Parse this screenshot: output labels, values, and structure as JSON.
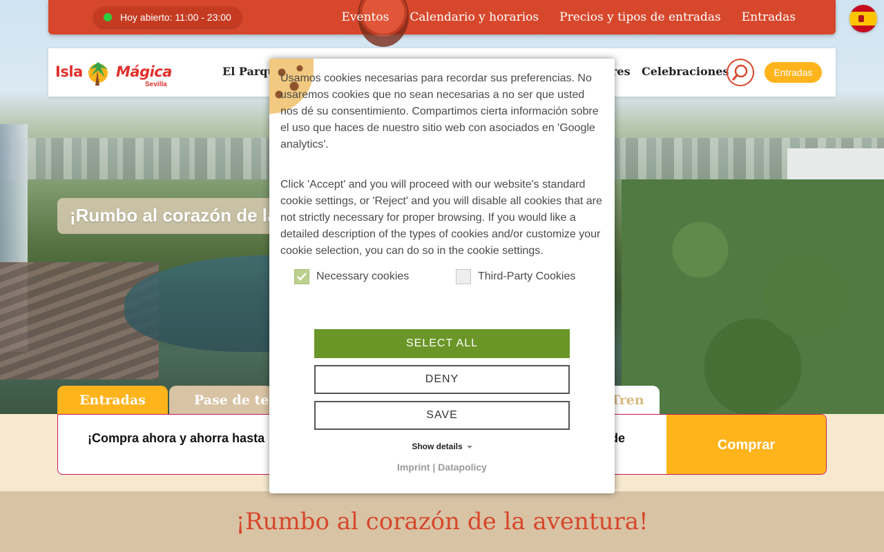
{
  "topbar": {
    "open_status": "Hoy abierto: 11:00 - 23:00",
    "nav": [
      "Eventos",
      "Calendario y horarios",
      "Precios y tipos de entradas",
      "Entradas"
    ],
    "language_flag": "spain-flag"
  },
  "mainbar": {
    "logo": {
      "word1": "Isla",
      "word2": "Mágica",
      "city": "Sevilla"
    },
    "nav_left": "El Parque",
    "nav_mid": "res",
    "nav_right": "Celebraciones",
    "search_icon": "search-icon",
    "tickets_button": "Entradas"
  },
  "hero": {
    "title": "¡Rumbo al corazón de la aventura!"
  },
  "tabs": [
    "Entradas",
    "Pase de temporada",
    "Tren"
  ],
  "promo": {
    "text_left": "¡Compra ahora y ahorra hasta",
    "text_right": "sde",
    "buy_button": "Comprar"
  },
  "bottom": {
    "title": "¡Rumbo al corazón de la aventura!"
  },
  "cookie": {
    "paragraph1": "Usamos cookies necesarias para recordar sus preferencias. No usaremos cookies que no sean necesarias a no ser que usted nos dé su consentimiento. Compartimos cierta información sobre el uso que haces de nuestro sitio web con asociados en 'Google analytics'.",
    "paragraph2": "Click 'Accept' and you will proceed with our website's standard cookie settings, or 'Reject' and you will disable all cookies that are not strictly necessary for proper browsing. If you would like a detailed description of the types of cookies and/or customize your cookie selection, you can do so in the cookie settings.",
    "checkbox_necessary": "Necessary cookies",
    "checkbox_third_party": "Third-Party Cookies",
    "select_all": "SELECT ALL",
    "deny": "DENY",
    "save": "SAVE",
    "show_details": "Show details",
    "imprint": "Imprint",
    "separator": "|",
    "datapolicy": "Datapolicy"
  },
  "colors": {
    "brand_red": "#d7472b",
    "accent_yellow": "#ffb41c",
    "cookie_green": "#6a9628",
    "sand": "#d8c3a5"
  }
}
